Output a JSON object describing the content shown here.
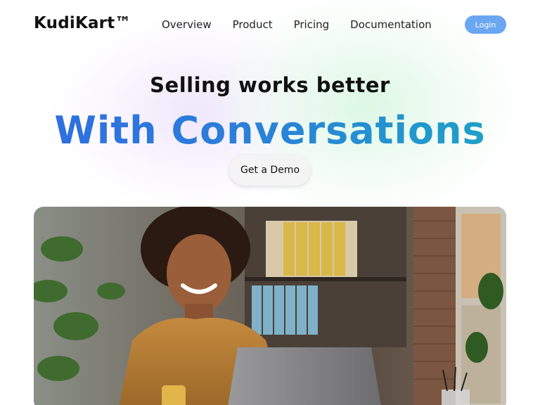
{
  "brand": {
    "logo": "KudiKart™"
  },
  "nav": {
    "links": [
      {
        "label": "Overview"
      },
      {
        "label": "Product"
      },
      {
        "label": "Pricing"
      },
      {
        "label": "Documentation"
      }
    ],
    "login_label": "Login"
  },
  "hero": {
    "subtitle": "Selling works better",
    "title": "With Conversations",
    "cta_label": "Get a Demo"
  },
  "colors": {
    "login_button": "#6aa6f2",
    "title_gradient_start": "#2f6fe0",
    "title_gradient_end": "#1fa0c8"
  },
  "icons": []
}
